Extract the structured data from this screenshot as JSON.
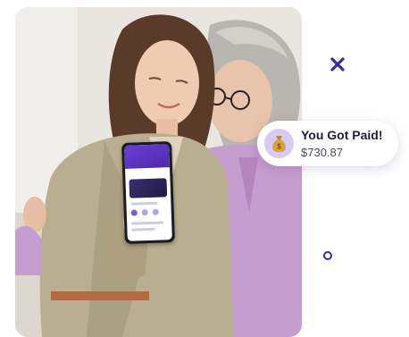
{
  "notification": {
    "icon": "money-bag-icon",
    "title": "You Got Paid!",
    "amount": "$730.87"
  },
  "photo": {
    "subject": "two-women-hugging-with-phone"
  },
  "colors": {
    "accent": "#3d2a9a",
    "icon_bg": "#d7cbf5",
    "icon_fg": "#c08a2a"
  }
}
